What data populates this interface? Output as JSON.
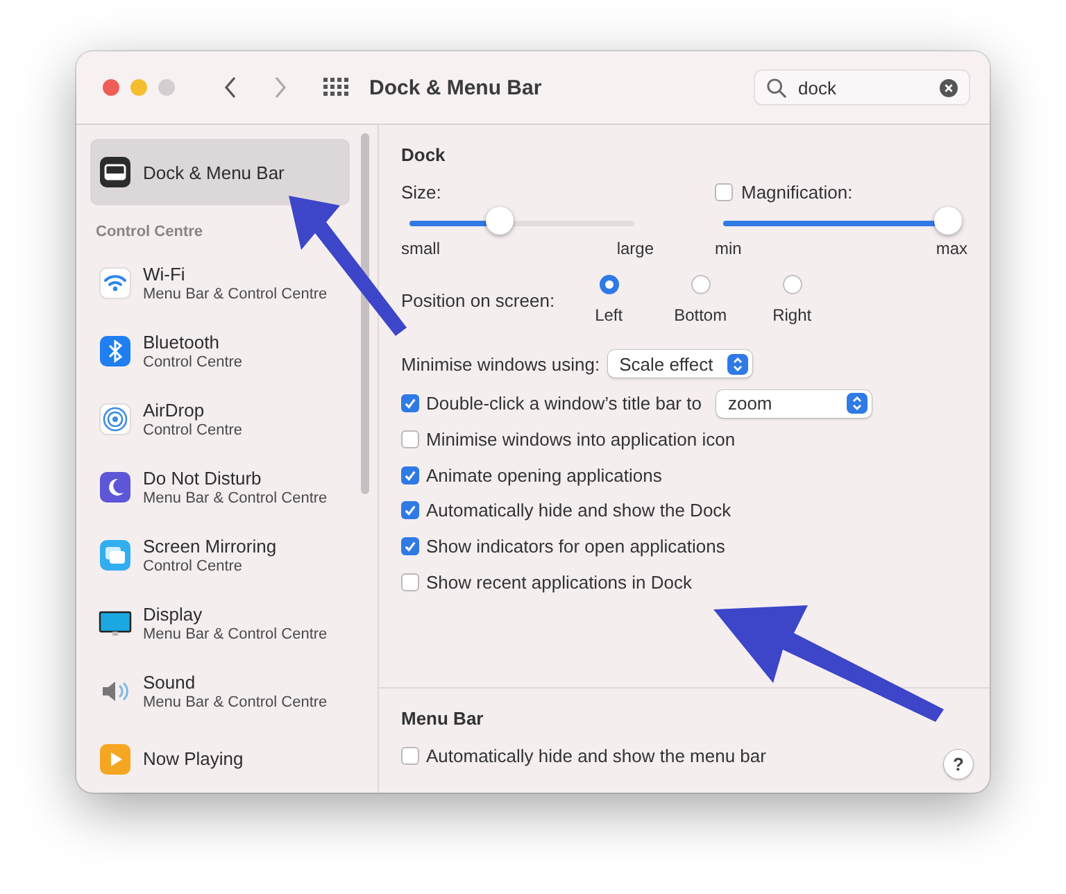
{
  "window": {
    "title": "Dock & Menu Bar"
  },
  "search": {
    "value": "dock"
  },
  "sidebar": {
    "top_item": {
      "label": "Dock & Menu Bar",
      "kind": "dock",
      "selected": true
    },
    "section_title": "Control Centre",
    "items": [
      {
        "label": "Wi-Fi",
        "subtitle": "Menu Bar & Control Centre",
        "kind": "wifi",
        "selected": false
      },
      {
        "label": "Bluetooth",
        "subtitle": "Control Centre",
        "kind": "bluetooth",
        "selected": false
      },
      {
        "label": "AirDrop",
        "subtitle": "Control Centre",
        "kind": "airdrop",
        "selected": false
      },
      {
        "label": "Do Not Disturb",
        "subtitle": "Menu Bar & Control Centre",
        "kind": "moon",
        "selected": false
      },
      {
        "label": "Screen Mirroring",
        "subtitle": "Control Centre",
        "kind": "mirroring",
        "selected": false
      },
      {
        "label": "Display",
        "subtitle": "Menu Bar & Control Centre",
        "kind": "display",
        "selected": false
      },
      {
        "label": "Sound",
        "subtitle": "Menu Bar & Control Centre",
        "kind": "sound",
        "selected": false
      },
      {
        "label": "Now Playing",
        "kind": "play",
        "selected": false
      }
    ]
  },
  "dock": {
    "title": "Dock",
    "size": {
      "label": "Size:",
      "level": 0.4,
      "min_label": "small",
      "max_label": "large"
    },
    "magnification": {
      "label": "Magnification:",
      "checked": false,
      "level": 1,
      "min_label": "min",
      "max_label": "max"
    },
    "position": {
      "label": "Position on screen:",
      "options": [
        {
          "label": "Left",
          "selected": true
        },
        {
          "label": "Bottom",
          "selected": false
        },
        {
          "label": "Right",
          "selected": false
        }
      ]
    },
    "minimise": {
      "label": "Minimise windows using:",
      "value": "Scale effect"
    },
    "options": [
      {
        "kind": "select",
        "label": "Double-click a window’s title bar to",
        "checked": true,
        "value": "zoom"
      },
      {
        "kind": "plain",
        "label": "Minimise windows into application icon",
        "checked": false
      },
      {
        "kind": "plain",
        "label": "Animate opening applications",
        "checked": true
      },
      {
        "kind": "plain",
        "label": "Automatically hide and show the Dock",
        "checked": true
      },
      {
        "kind": "plain",
        "label": "Show indicators for open applications",
        "checked": true
      },
      {
        "kind": "plain",
        "label": "Show recent applications in Dock",
        "checked": false
      }
    ]
  },
  "menu_bar": {
    "title": "Menu Bar",
    "options": [
      {
        "kind": "plain",
        "label": "Automatically hide and show the menu bar",
        "checked": false
      }
    ]
  },
  "help": {
    "label": "?"
  }
}
